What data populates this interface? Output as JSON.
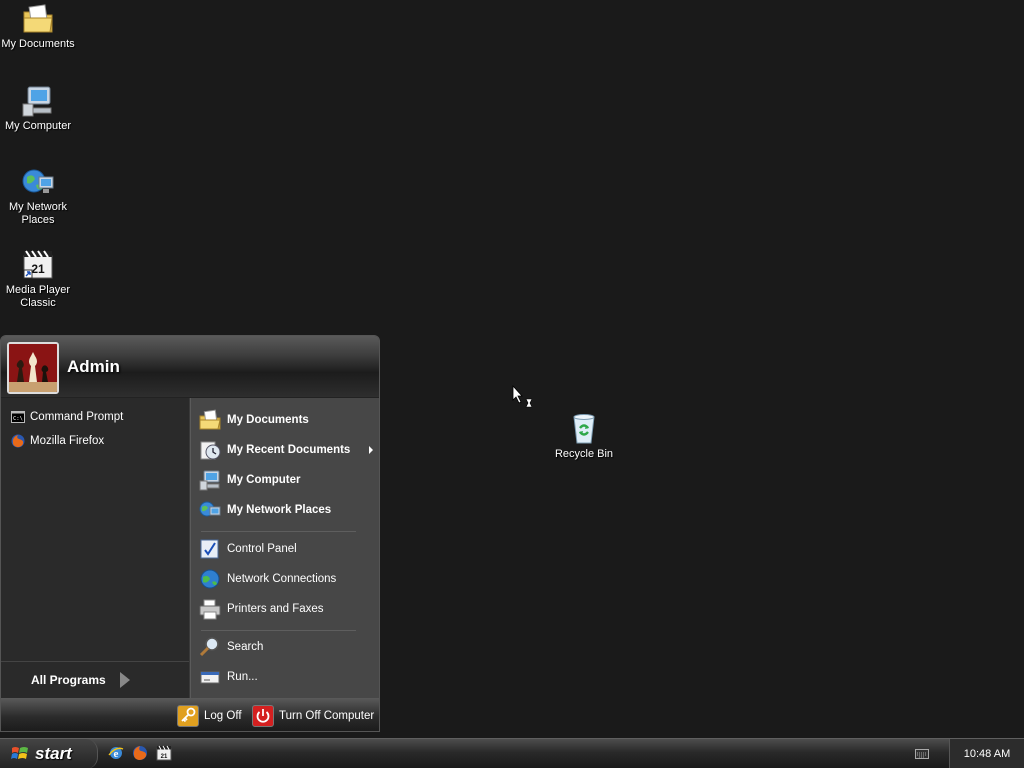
{
  "desktop": {
    "icons": [
      {
        "label": "My Documents",
        "icon": "my-documents-icon"
      },
      {
        "label": "My Computer",
        "icon": "my-computer-icon"
      },
      {
        "label": "My Network\nPlaces",
        "icon": "network-places-icon"
      },
      {
        "label": "Media Player\nClassic",
        "icon": "media-player-classic-icon"
      },
      {
        "label": "Recycle Bin",
        "icon": "recycle-bin-icon"
      }
    ]
  },
  "start_menu": {
    "username": "Admin",
    "pinned": [
      {
        "label": "Command Prompt",
        "icon": "command-prompt-icon"
      },
      {
        "label": "Mozilla Firefox",
        "icon": "firefox-icon"
      }
    ],
    "all_programs_label": "All Programs",
    "places": [
      {
        "label": "My Documents",
        "icon": "my-documents-icon"
      },
      {
        "label": "My Recent Documents",
        "icon": "recent-documents-icon"
      },
      {
        "label": "My Computer",
        "icon": "my-computer-icon"
      },
      {
        "label": "My Network Places",
        "icon": "network-places-icon"
      }
    ],
    "settings": [
      {
        "label": "Control Panel",
        "icon": "control-panel-icon"
      },
      {
        "label": "Network Connections",
        "icon": "network-connections-icon"
      },
      {
        "label": "Printers and Faxes",
        "icon": "printer-icon"
      }
    ],
    "tools": [
      {
        "label": "Search",
        "icon": "search-icon"
      },
      {
        "label": "Run...",
        "icon": "run-icon"
      }
    ],
    "footer": {
      "log_off_label": "Log Off",
      "turn_off_label": "Turn Off Computer"
    }
  },
  "taskbar": {
    "start_label": "start",
    "quick_launch": [
      "internet-explorer-icon",
      "firefox-icon",
      "media-player-classic-icon"
    ],
    "clock": "10:48 AM"
  },
  "colors": {
    "desktop_bg": "#1a1a1a",
    "menu_bg": "#3a3a3a",
    "taskbar_bg": "#2a2a2a",
    "turn_off_red": "#d42020"
  }
}
